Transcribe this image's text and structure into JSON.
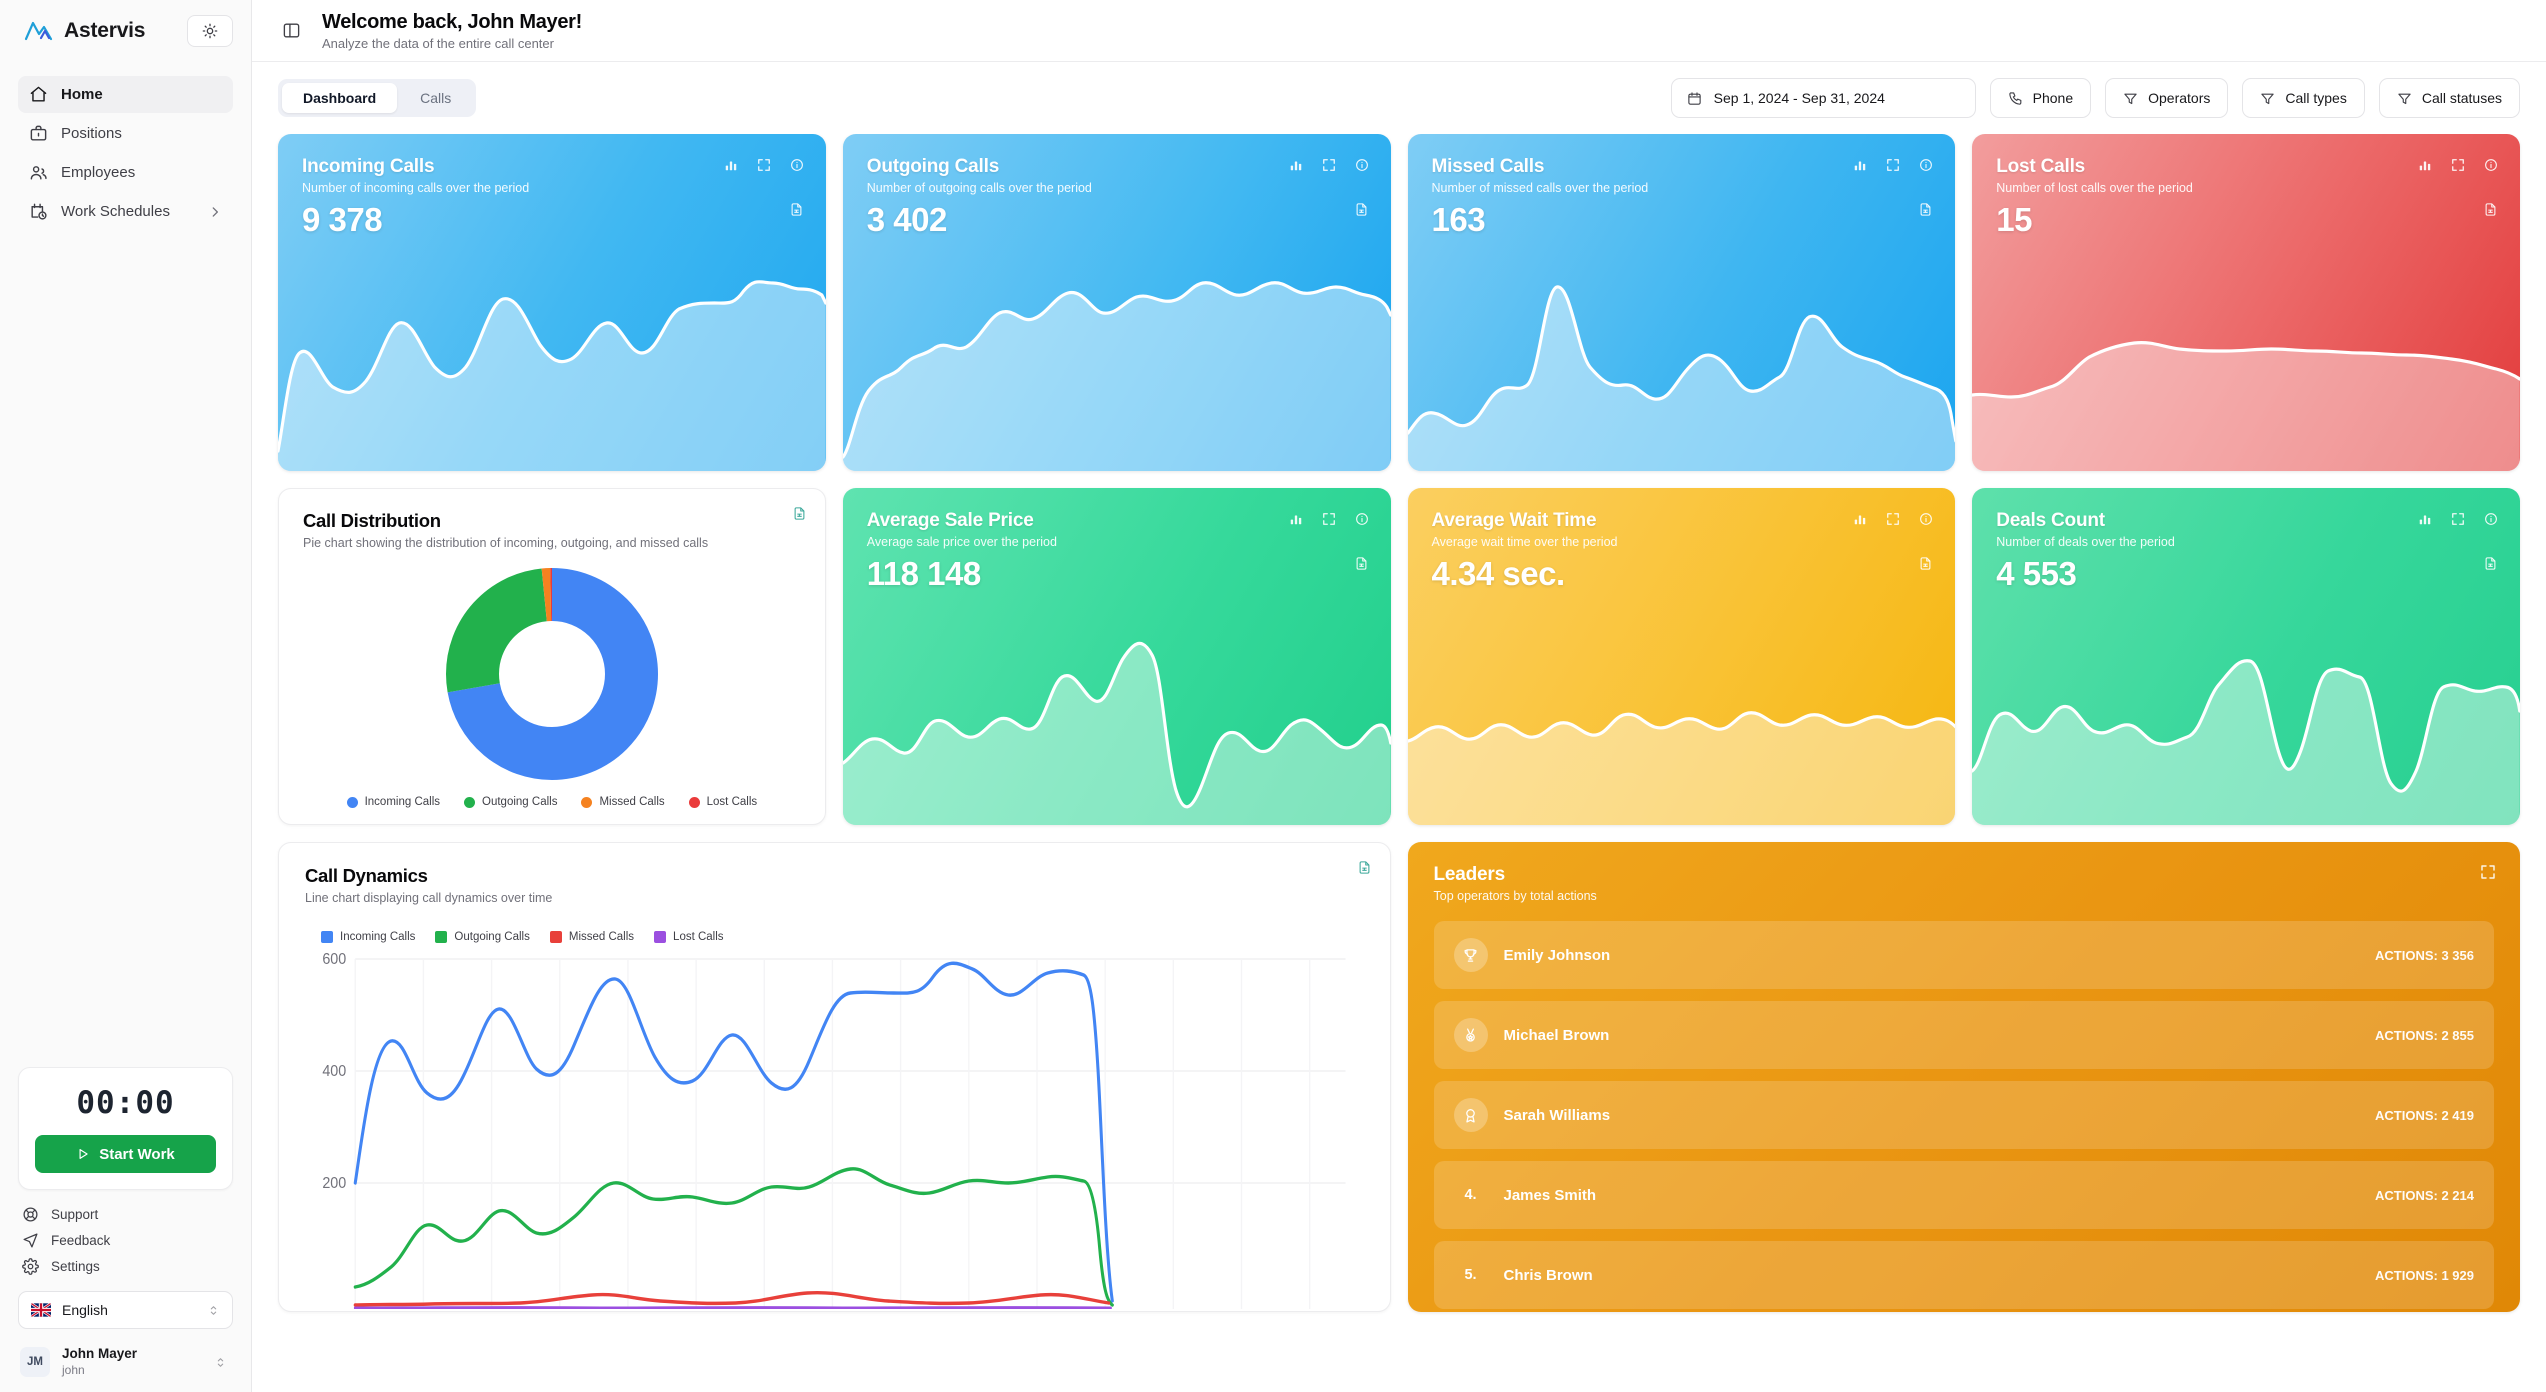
{
  "brand": {
    "name": "Astervis",
    "theme_icon": "sun-icon"
  },
  "sidebar": {
    "nav": [
      {
        "label": "Home",
        "icon": "home-icon",
        "active": true
      },
      {
        "label": "Positions",
        "icon": "briefcase-icon",
        "active": false
      },
      {
        "label": "Employees",
        "icon": "users-icon",
        "active": false
      },
      {
        "label": "Work Schedules",
        "icon": "calendar-clock-icon",
        "active": false,
        "chevron": "chevron-right-icon"
      }
    ],
    "timer": {
      "value": "00:00",
      "start_label": "Start Work",
      "start_icon": "play-icon"
    },
    "links": [
      {
        "label": "Support",
        "icon": "lifebuoy-icon"
      },
      {
        "label": "Feedback",
        "icon": "send-icon"
      },
      {
        "label": "Settings",
        "icon": "gear-icon"
      }
    ],
    "language": {
      "label": "English",
      "flag": "uk-flag-icon",
      "chevron": "chevron-up-down-icon"
    },
    "user": {
      "initials": "JM",
      "name": "John Mayer",
      "handle": "john",
      "chevron": "chevron-up-down-icon"
    }
  },
  "header": {
    "collapse_icon": "panel-collapse-icon",
    "title": "Welcome back, John Mayer!",
    "subtitle": "Analyze the data of the entire call center"
  },
  "toolbar": {
    "tabs": [
      {
        "label": "Dashboard",
        "active": true
      },
      {
        "label": "Calls",
        "active": false
      }
    ],
    "date_range": {
      "label": "Sep 1, 2024 - Sep 31, 2024",
      "icon": "calendar-icon"
    },
    "filters": [
      {
        "label": "Phone",
        "icon": "phone-icon"
      },
      {
        "label": "Operators",
        "icon": "filter-icon"
      },
      {
        "label": "Call types",
        "icon": "filter-icon"
      },
      {
        "label": "Call statuses",
        "icon": "filter-icon"
      }
    ]
  },
  "stat_cards": [
    {
      "title": "Incoming Calls",
      "subtitle": "Number of incoming calls over the period",
      "value": "9 378",
      "theme": "sc-blue1"
    },
    {
      "title": "Outgoing Calls",
      "subtitle": "Number of outgoing calls over the period",
      "value": "3 402",
      "theme": "sc-blue2"
    },
    {
      "title": "Missed Calls",
      "subtitle": "Number of missed calls over the period",
      "value": "163",
      "theme": "sc-blue3"
    },
    {
      "title": "Lost Calls",
      "subtitle": "Number of lost calls over the period",
      "value": "15",
      "theme": "sc-red"
    },
    {
      "title": "Average Sale Price",
      "subtitle": "Average sale price over the period",
      "value": "118 148",
      "theme": "sc-green"
    },
    {
      "title": "Average Wait Time",
      "subtitle": "Average wait time over the period",
      "value": "4.34 sec.",
      "theme": "sc-amber"
    },
    {
      "title": "Deals Count",
      "subtitle": "Number of deals over the period",
      "value": "4 553",
      "theme": "sc-green2"
    }
  ],
  "card_icons": {
    "bar": "bar-chart-icon",
    "expand": "expand-icon",
    "info": "info-circle-icon",
    "export": "export-spreadsheet-icon"
  },
  "call_distribution": {
    "title": "Call Distribution",
    "subtitle": "Pie chart showing the distribution of incoming, outgoing, and missed calls",
    "export_icon": "export-spreadsheet-icon"
  },
  "call_dynamics": {
    "title": "Call Dynamics",
    "subtitle": "Line chart displaying call dynamics over time",
    "export_icon": "export-spreadsheet-icon"
  },
  "leaders": {
    "title": "Leaders",
    "subtitle": "Top operators by total actions",
    "expand_icon": "expand-icon",
    "rows": [
      {
        "rank": "1",
        "medal": "trophy-icon",
        "name": "Emily Johnson",
        "actions": "ACTIONS: 3 356"
      },
      {
        "rank": "2",
        "medal": "medal-icon",
        "name": "Michael Brown",
        "actions": "ACTIONS: 2 855"
      },
      {
        "rank": "3",
        "medal": "ribbon-icon",
        "name": "Sarah Williams",
        "actions": "ACTIONS: 2 419"
      },
      {
        "rank": "4.",
        "medal": null,
        "name": "James Smith",
        "actions": "ACTIONS: 2 214"
      },
      {
        "rank": "5.",
        "medal": null,
        "name": "Chris Brown",
        "actions": "ACTIONS: 1 929"
      }
    ]
  },
  "colors": {
    "incoming": "#4285f4",
    "outgoing": "#22b14c",
    "missed": "#f58220",
    "lost": "#ea3b3b",
    "dyn_missed": "#e8403a",
    "dyn_lost": "#9b4fe0",
    "green_accent": "#16a34a",
    "leaders_accent": "#ea9612"
  },
  "chart_data": [
    {
      "type": "pie",
      "title": "Call Distribution",
      "subtitle": "Pie chart showing the distribution of incoming, outgoing, and missed calls",
      "donut": true,
      "legend_position": "bottom",
      "categories": [
        "Incoming Calls",
        "Outgoing Calls",
        "Missed Calls",
        "Lost Calls"
      ],
      "values": [
        9378,
        3402,
        163,
        15
      ],
      "percentages": [
        72.2,
        26.2,
        1.3,
        0.1
      ],
      "colors": [
        "#4285f4",
        "#22b14c",
        "#f58220",
        "#ea3b3b"
      ]
    },
    {
      "type": "line",
      "title": "Call Dynamics",
      "subtitle": "Line chart displaying call dynamics over time",
      "xlabel": "",
      "ylabel": "",
      "ylim": [
        0,
        640
      ],
      "yticks": [
        200,
        400,
        600
      ],
      "ytick_labels": [
        "200",
        "400",
        "600"
      ],
      "grid": true,
      "legend_position": "top-left",
      "x": [
        1,
        2,
        3,
        4,
        5,
        6,
        7,
        8,
        9,
        10,
        11,
        12,
        13,
        14,
        15,
        16,
        17,
        18,
        19,
        20,
        21,
        22,
        23,
        24,
        25,
        26,
        27,
        28,
        29,
        30
      ],
      "series": [
        {
          "name": "Incoming Calls",
          "color": "#4285f4",
          "values": [
            215,
            450,
            350,
            380,
            495,
            388,
            560,
            455,
            420,
            478,
            378,
            535,
            537,
            592,
            535,
            580,
            580,
            60
          ]
        },
        {
          "name": "Outgoing Calls",
          "color": "#22b14c",
          "values": [
            28,
            125,
            100,
            168,
            140,
            200,
            170,
            182,
            165,
            195,
            228,
            182,
            207,
            203,
            215,
            10
          ]
        },
        {
          "name": "Missed Calls",
          "color": "#e8403a",
          "values": [
            4,
            6,
            5,
            9,
            7,
            22,
            10,
            6,
            5,
            18,
            8,
            6,
            14,
            5,
            3
          ]
        },
        {
          "name": "Lost Calls",
          "color": "#9b4fe0",
          "values": [
            0,
            1,
            0,
            2,
            0,
            1,
            0,
            0,
            1,
            0,
            0,
            1,
            0,
            0,
            0
          ]
        }
      ]
    },
    {
      "type": "area",
      "title": "Incoming Calls sparkline",
      "values": [
        18,
        55,
        38,
        30,
        52,
        40,
        28,
        60,
        45,
        35,
        40,
        32,
        58,
        65,
        56,
        64,
        62,
        5
      ]
    },
    {
      "type": "area",
      "title": "Outgoing Calls sparkline",
      "values": [
        5,
        18,
        32,
        40,
        35,
        48,
        52,
        45,
        60,
        66,
        58,
        64,
        70,
        62,
        72,
        78,
        72,
        70,
        8
      ]
    },
    {
      "type": "area",
      "title": "Missed Calls sparkline",
      "values": [
        12,
        20,
        16,
        30,
        80,
        45,
        30,
        26,
        22,
        42,
        30,
        26,
        62,
        46,
        40,
        34,
        30,
        5
      ]
    },
    {
      "type": "area",
      "title": "Lost Calls sparkline",
      "values": [
        14,
        12,
        13,
        15,
        18,
        28,
        34,
        30,
        26,
        27,
        28,
        30,
        29,
        28,
        27,
        26,
        25,
        20
      ]
    },
    {
      "type": "area",
      "title": "Average Sale Price sparkline",
      "values": [
        22,
        35,
        30,
        46,
        40,
        34,
        60,
        72,
        40,
        34,
        90,
        20,
        28,
        40,
        52,
        36,
        44,
        5
      ]
    },
    {
      "type": "area",
      "title": "Average Wait Time sparkline",
      "values": [
        30,
        42,
        34,
        46,
        38,
        48,
        40,
        50,
        42,
        54,
        44,
        52,
        46,
        56,
        48,
        58,
        50,
        44
      ]
    },
    {
      "type": "area",
      "title": "Deals Count sparkline",
      "values": [
        20,
        52,
        44,
        58,
        50,
        42,
        48,
        40,
        36,
        60,
        88,
        40,
        78,
        84,
        30,
        70,
        76,
        6
      ]
    }
  ]
}
